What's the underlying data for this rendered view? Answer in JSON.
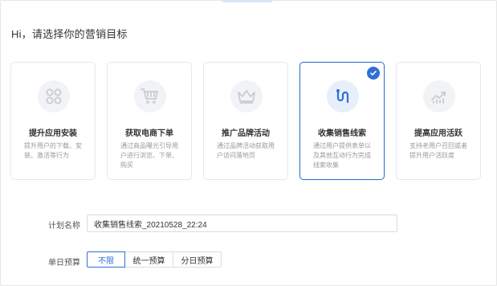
{
  "greeting": "Hi，请选择你的营销目标",
  "cards": [
    {
      "icon": "apps-grid-icon",
      "title": "提升应用安装",
      "desc": "提升用户的下载、安装、激活等行为",
      "selected": false
    },
    {
      "icon": "shopping-cart-icon",
      "title": "获取电商下单",
      "desc": "通过商品曝光引导用户进行浏览、下单、购买",
      "selected": false
    },
    {
      "icon": "crown-icon",
      "title": "推广品牌活动",
      "desc": "通过品牌活动获取用户访问落地页",
      "selected": false
    },
    {
      "icon": "route-path-icon",
      "title": "收集销售线索",
      "desc": "通过用户提供表单以及其他互动行为完成线索收集",
      "selected": true
    },
    {
      "icon": "growth-chart-icon",
      "title": "提高应用活跃",
      "desc": "支持老用户召回或者提升用户活跃度",
      "selected": false
    }
  ],
  "form": {
    "plan_name_label": "计划名称",
    "plan_name_value": "收集销售线索_20210528_22:24",
    "budget_label": "单日预算",
    "budget_options": [
      "不限",
      "统一预算",
      "分日预算"
    ],
    "budget_selected": "不限"
  },
  "colors": {
    "accent": "#2f6fd6",
    "icon_gray": "#c8ccd2"
  }
}
